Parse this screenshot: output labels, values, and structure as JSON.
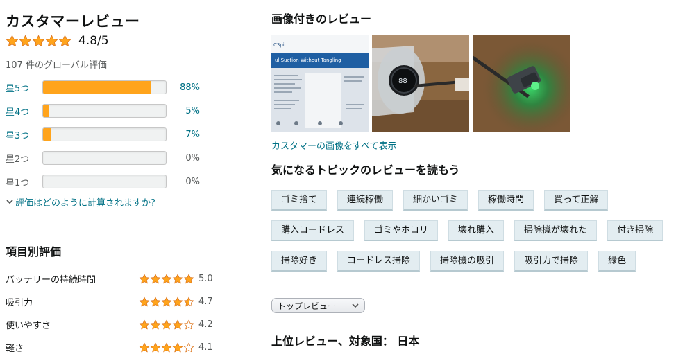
{
  "summary": {
    "title": "カスタマーレビュー",
    "overall_rating": 4.8,
    "overall_label": "4.8/5",
    "global_count": "107 件のグローバル評価",
    "how_calculated": "評価はどのように計算されますか?"
  },
  "histogram": [
    {
      "label": "星5つ",
      "percent": 88,
      "percent_label": "88%",
      "linked": true
    },
    {
      "label": "星4つ",
      "percent": 5,
      "percent_label": "5%",
      "linked": true
    },
    {
      "label": "星3つ",
      "percent": 7,
      "percent_label": "7%",
      "linked": true
    },
    {
      "label": "星2つ",
      "percent": 0,
      "percent_label": "0%",
      "linked": false
    },
    {
      "label": "星1つ",
      "percent": 0,
      "percent_label": "0%",
      "linked": false
    }
  ],
  "attributes": {
    "title": "項目別評価",
    "items": [
      {
        "name": "バッテリーの持続時間",
        "rating": 5.0,
        "rating_label": "5.0"
      },
      {
        "name": "吸引力",
        "rating": 4.7,
        "rating_label": "4.7"
      },
      {
        "name": "使いやすさ",
        "rating": 4.2,
        "rating_label": "4.2"
      },
      {
        "name": "軽さ",
        "rating": 4.1,
        "rating_label": "4.1"
      }
    ]
  },
  "images": {
    "title": "画像付きのレビュー",
    "see_all": "カスタマーの画像をすべて表示",
    "photo1_text": "ul Suction Without Tangling"
  },
  "topics": {
    "title": "気になるトピックのレビューを読もう",
    "rows": [
      [
        "ゴミ捨て",
        "連続稼働",
        "細かいゴミ",
        "稼働時間",
        "買って正解"
      ],
      [
        "購入コードレス",
        "ゴミやホコリ",
        "壊れ購入",
        "掃除機が壊れた",
        "付き掃除"
      ],
      [
        "掃除好き",
        "コードレス掃除",
        "掃除機の吸引",
        "吸引力で掃除",
        "緑色"
      ]
    ]
  },
  "sort": {
    "selected": "トップレビュー"
  },
  "top_reviews": {
    "title": "上位レビュー、対象国： 日本"
  },
  "colors": {
    "star": "#ffa41c",
    "star_outline": "#de7921",
    "link": "#007185",
    "pill_bg": "#e3edf1"
  }
}
